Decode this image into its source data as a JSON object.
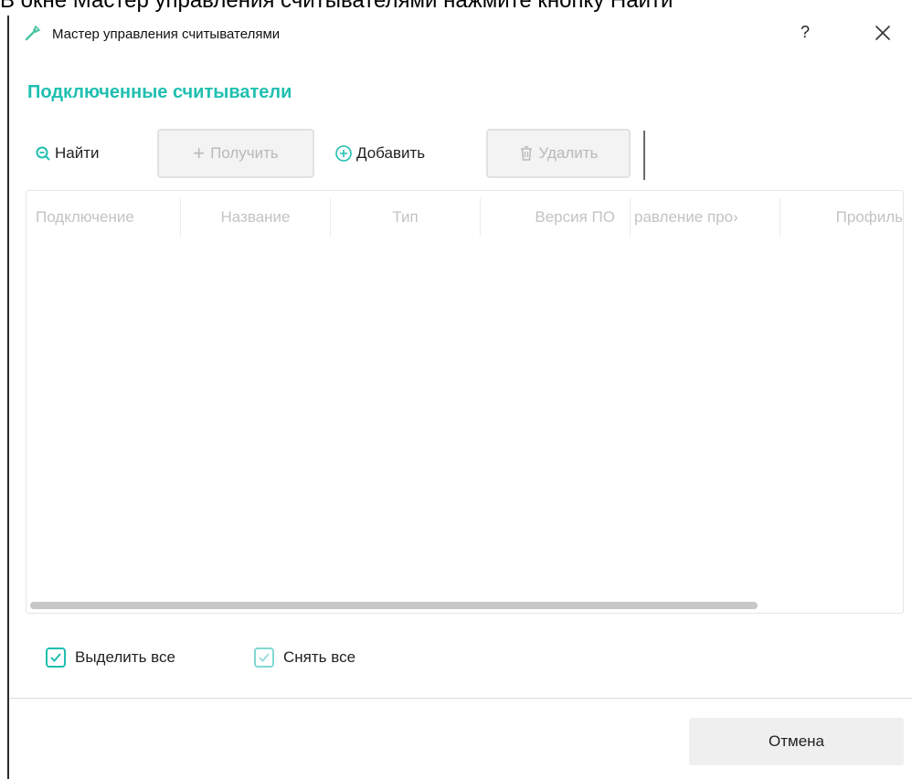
{
  "doc_text": "В окне Мастер управления считывателями нажмите кнопку Найти",
  "window": {
    "title": "Мастер управления считывателями",
    "help_label": "?"
  },
  "section_title": "Подключенные считыватели",
  "toolbar": {
    "find_label": "Найти",
    "get_label": "Получить",
    "add_label": "Добавить",
    "delete_label": "Удалить"
  },
  "table": {
    "columns": [
      "Подключение",
      "Название",
      "Тип",
      "Версия ПО",
      "равление про›",
      "Профиль"
    ],
    "rows": []
  },
  "select_all_label": "Выделить все",
  "deselect_all_label": "Снять все",
  "cancel_label": "Отмена",
  "colors": {
    "accent": "#1fbfb0",
    "disabled_text": "#b9b9b9",
    "header_text": "#c3c3c3"
  }
}
